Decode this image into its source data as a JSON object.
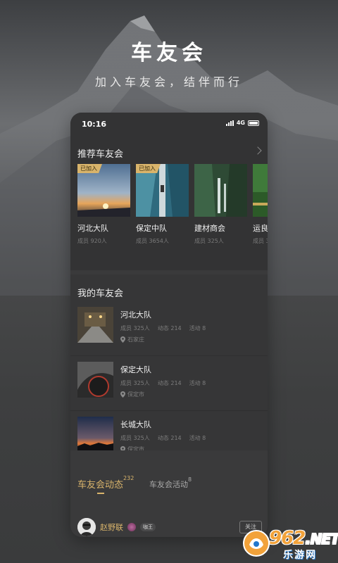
{
  "hero": {
    "title": "车友会",
    "subtitle": "加入车友会，结伴而行"
  },
  "status_bar": {
    "time": "10:16",
    "network": "4G"
  },
  "recommended": {
    "header": "推荐车友会",
    "clubs": [
      {
        "name": "河北大队",
        "members": "成员 920人",
        "badge": "已加入"
      },
      {
        "name": "保定中队",
        "members": "成员 3654人",
        "badge": "已加入"
      },
      {
        "name": "建材商会",
        "members": "成员 325人",
        "badge": ""
      },
      {
        "name": "运良",
        "members": "成员 3",
        "badge": ""
      }
    ]
  },
  "my_clubs": {
    "header": "我的车友会",
    "items": [
      {
        "name": "河北大队",
        "members": "成员 325人",
        "posts": "动态 214",
        "events": "活动 8",
        "location": "石家庄"
      },
      {
        "name": "保定大队",
        "members": "成员 325人",
        "posts": "动态 214",
        "events": "活动 8",
        "location": "保定市"
      },
      {
        "name": "长城大队",
        "members": "成员 325人",
        "posts": "动态 214",
        "events": "活动 8",
        "location": "保定市"
      }
    ]
  },
  "feed": {
    "tab_active": "车友会动态",
    "tab_active_count": "232",
    "tab_other": "车友会活动",
    "tab_other_count": "8",
    "user": {
      "name": "赵野联",
      "level": "咖王"
    },
    "follow_label": "关注"
  },
  "watermark": {
    "number": "962",
    "dot": ".",
    "tld": "NET",
    "site": "乐游网"
  },
  "colors": {
    "accent": "#d9b46b",
    "card_bg": "#3a3a3b",
    "watermark_orange": "#f2a23a"
  }
}
